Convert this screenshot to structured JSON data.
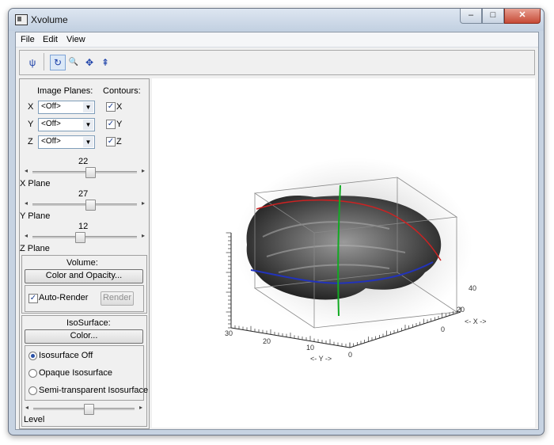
{
  "window": {
    "title": "Xvolume",
    "controls": {
      "minimize": "–",
      "maximize": "□",
      "close": "✕"
    }
  },
  "menu": [
    "File",
    "Edit",
    "View"
  ],
  "toolbar": {
    "icons": [
      "axes-tool-icon",
      "rotate-icon",
      "zoom-icon",
      "pan-icon",
      "select-icon"
    ],
    "glyphs": [
      "ψ",
      "↻",
      "🔍",
      "✥",
      "⇞"
    ],
    "pressed_index": 1
  },
  "planes": {
    "image_planes_label": "Image Planes:",
    "contours_label": "Contours:",
    "rows": [
      {
        "axis": "X",
        "value": "<Off>",
        "contour_label": "X",
        "contour_checked": true
      },
      {
        "axis": "Y",
        "value": "<Off>",
        "contour_label": "Y",
        "contour_checked": true
      },
      {
        "axis": "Z",
        "value": "<Off>",
        "contour_label": "Z",
        "contour_checked": true
      }
    ]
  },
  "sliders": [
    {
      "value": "22",
      "label": "X Plane",
      "position": 0.55
    },
    {
      "value": "27",
      "label": "Y Plane",
      "position": 0.55
    },
    {
      "value": "12",
      "label": "Z Plane",
      "position": 0.45
    }
  ],
  "volume": {
    "title": "Volume:",
    "color_button": "Color and Opacity...",
    "auto_render_label": "Auto-Render",
    "auto_render_checked": true,
    "render_button": "Render"
  },
  "isosurface": {
    "title": "IsoSurface:",
    "color_button": "Color...",
    "options": [
      "Isosurface Off",
      "Opaque Isosurface",
      "Semi-transparent Isosurface"
    ],
    "selected_index": 0,
    "level_label": "Level",
    "level_position": 0.55
  },
  "plot": {
    "x_axis_label": "<- X ->",
    "y_axis_label": "<- Y ->",
    "x_ticks": [
      "0",
      "20",
      "40"
    ],
    "y_ticks": [
      "0",
      "10",
      "20",
      "30"
    ],
    "colors": {
      "x_contour": "#cc2222",
      "y_contour": "#2233bb",
      "z_contour": "#11aa22"
    }
  }
}
